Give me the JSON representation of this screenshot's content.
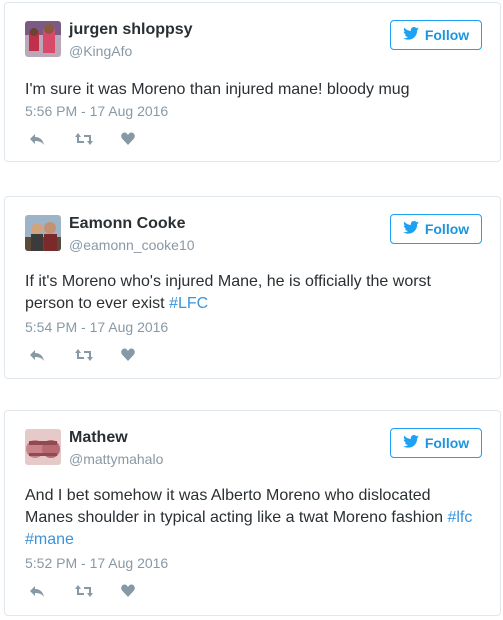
{
  "colors": {
    "link": "#3b94d9",
    "follow": "#1b95e0",
    "muted": "#8899a6",
    "border": "#e1e8ed"
  },
  "follow_label": "Follow",
  "tweets": [
    {
      "name": "jurgen shloppsy",
      "handle": "@KingAfo",
      "text": "I'm sure it was Moreno than injured mane! bloody mug",
      "tags": [],
      "time": "5:56 PM - 17 Aug 2016"
    },
    {
      "name": "Eamonn Cooke",
      "handle": "@eamonn_cooke10",
      "text": "If it's Moreno who's injured Mane, he is officially the worst person to ever exist",
      "tags": [
        "#LFC"
      ],
      "time": "5:54 PM - 17 Aug 2016"
    },
    {
      "name": "Mathew",
      "handle": "@mattymahalo",
      "text": "And I bet somehow it was Alberto Moreno who dislocated Manes shoulder in typical acting like a twat Moreno fashion",
      "tags": [
        "#lfc",
        "#mane"
      ],
      "time": "5:52 PM - 17 Aug 2016"
    }
  ]
}
